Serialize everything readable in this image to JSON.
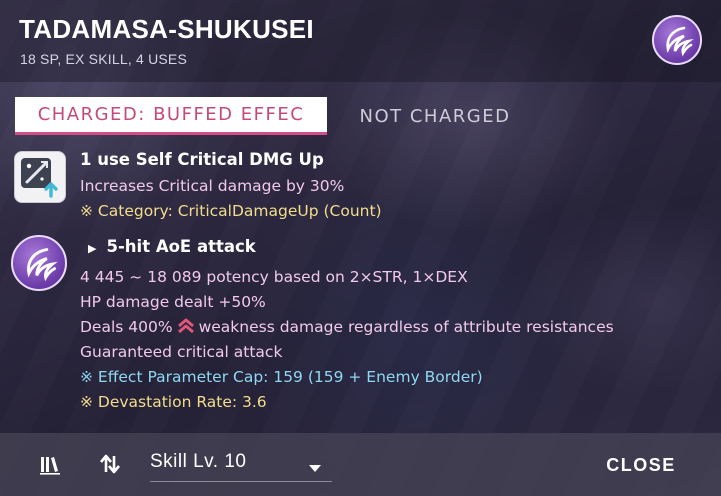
{
  "header": {
    "title": "TADAMASA-SHUKUSEI",
    "subtitle": "18 SP, EX SKILL, 4 USES"
  },
  "tabs": [
    {
      "label": "CHARGED: BUFFED EFFEC",
      "active": true
    },
    {
      "label": "NOT CHARGED",
      "active": false
    }
  ],
  "buff": {
    "name": "1 use Self Critical DMG Up",
    "description": "Increases Critical damage by 30%",
    "category": "※ Category: CriticalDamageUp (Count)",
    "icon": "critical-damage-up-icon"
  },
  "attack": {
    "name": "5-hit AoE attack",
    "potency": "4 445 ~ 18 089 potency based on 2×STR, 1×DEX",
    "hp_damage": "HP damage dealt +50%",
    "weakness_prefix": "Deals 400%",
    "weakness_suffix": "weakness damage regardless of attribute resistances",
    "critical": "Guaranteed critical attack",
    "param_cap": "※ Effect Parameter Cap: 159 (159 + Enemy Border)",
    "devastation": "※ Devastation Rate: 3.6"
  },
  "footer": {
    "skill_level": "Skill Lv. 10",
    "close_label": "CLOSE"
  },
  "colors": {
    "accent_pink": "#c4497c",
    "text_pink": "#f1c9ea",
    "text_yellow": "#f2dd8e",
    "text_cyan": "#8fd8f2",
    "emblem_purple": "#7a46b8"
  }
}
